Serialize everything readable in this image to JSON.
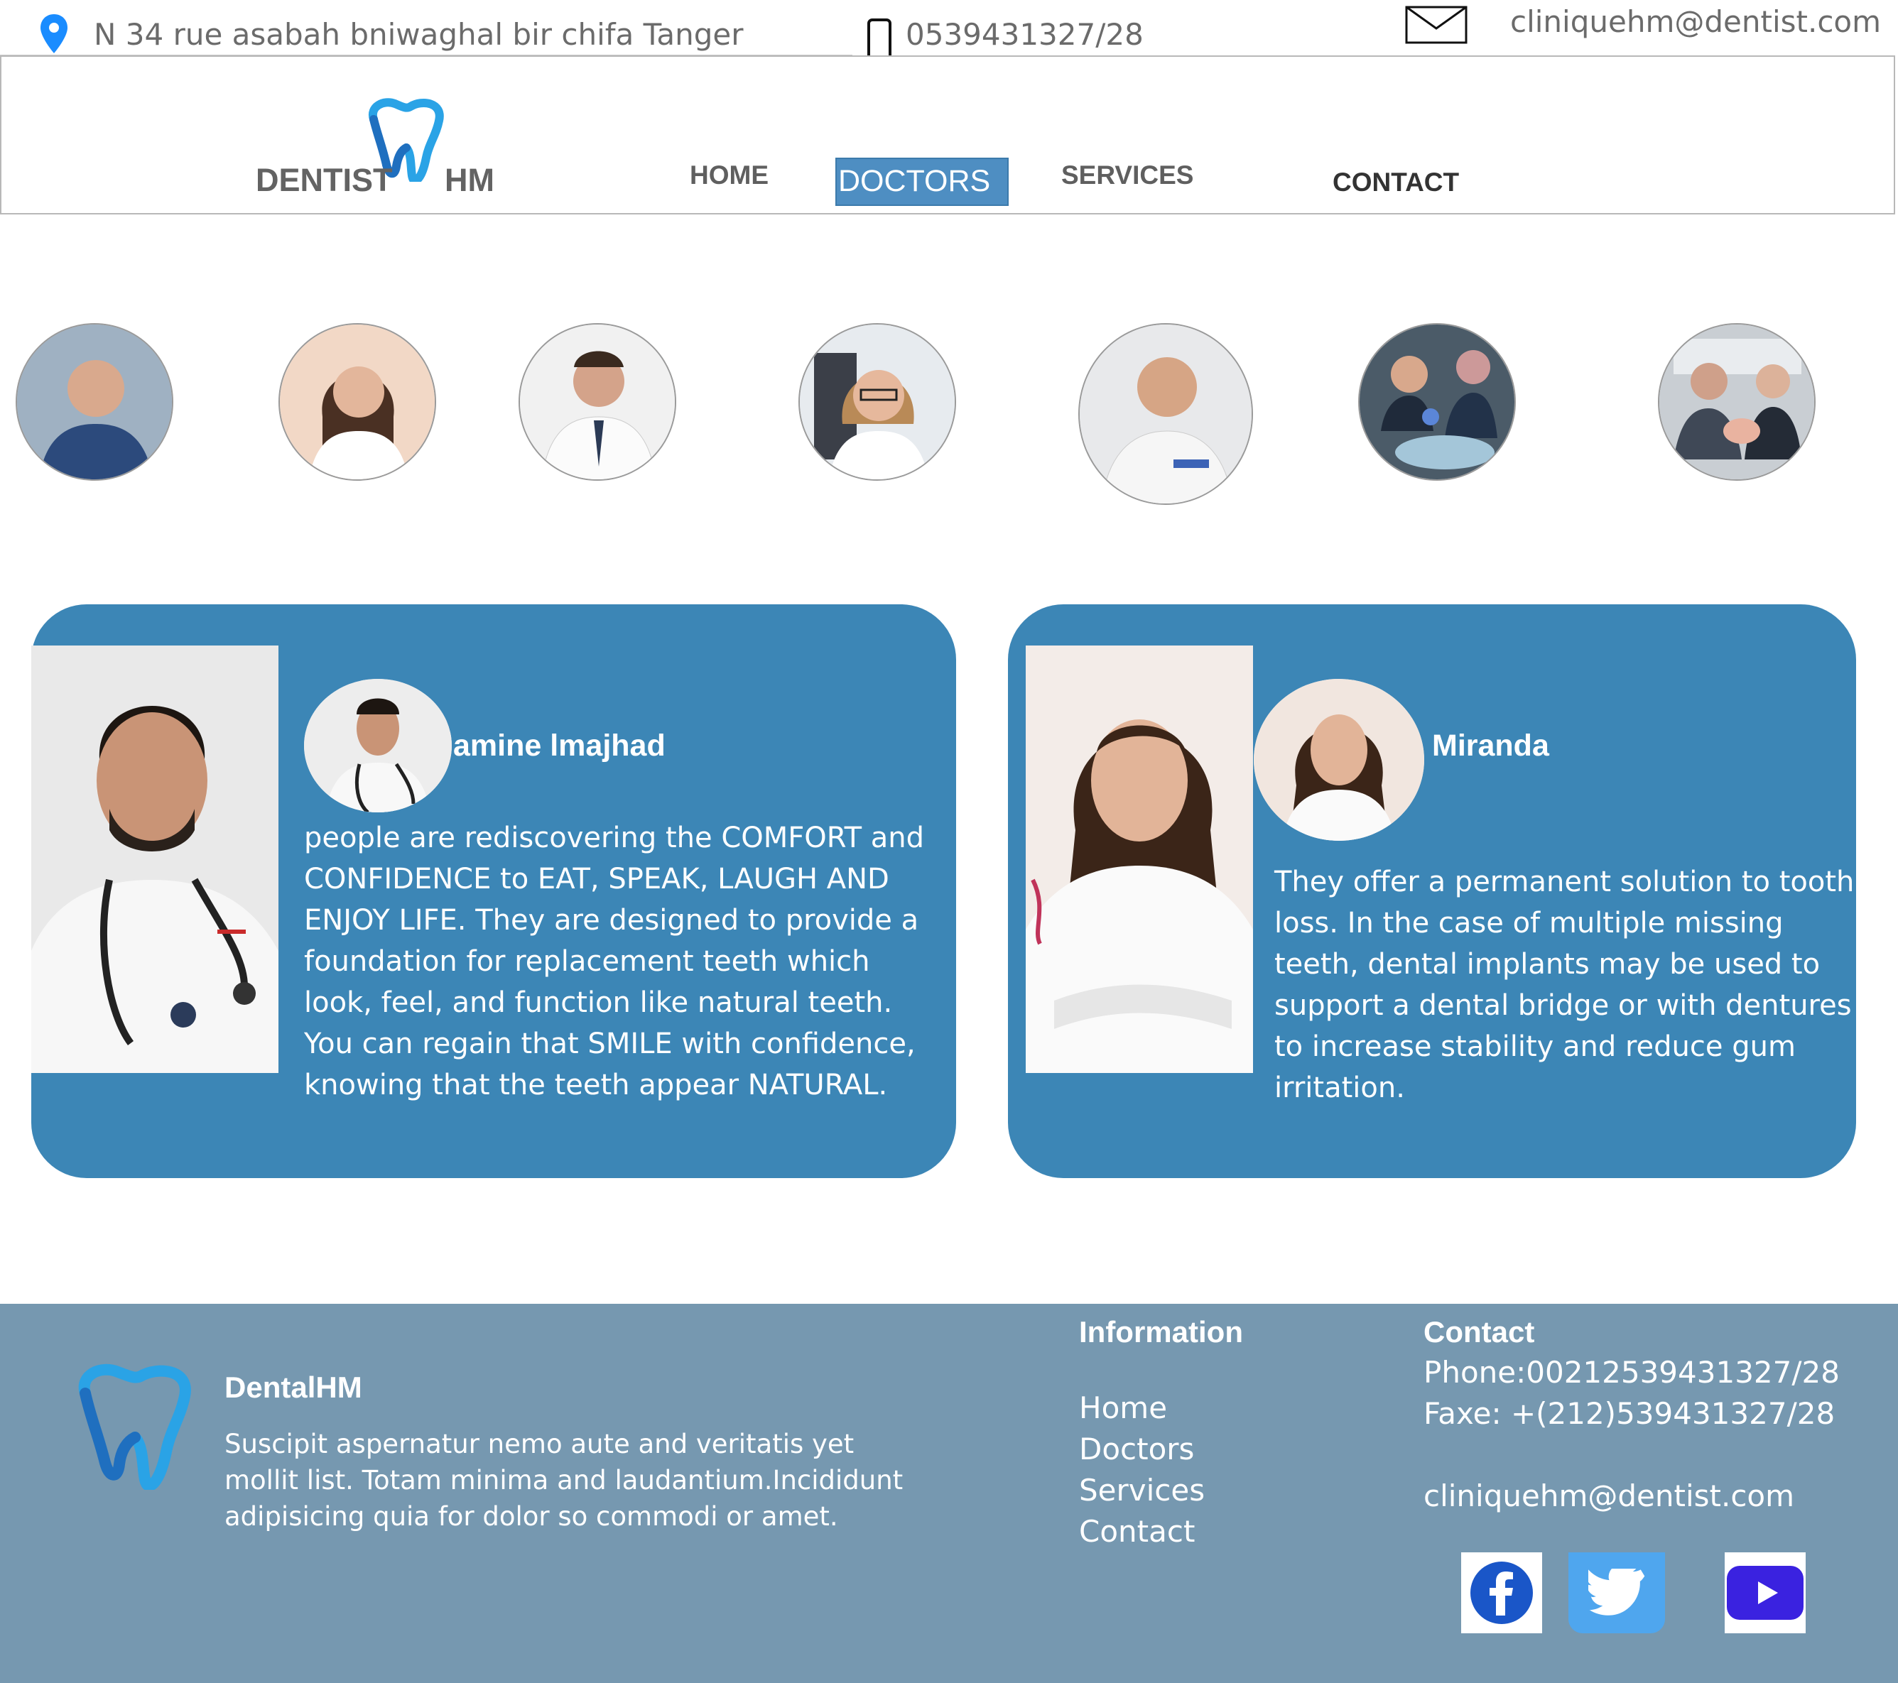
{
  "topbar": {
    "address": "N 34 rue asabah bniwaghal bir chifa Tanger",
    "phone": "0539431327/28",
    "email": "cliniquehm@dentist.com"
  },
  "logo": {
    "word_left": "DENTIST",
    "word_right": "HM",
    "icon": "tooth-logo-icon"
  },
  "nav": {
    "items": [
      {
        "label": "HOME"
      },
      {
        "label": "DOCTORS",
        "active": true
      },
      {
        "label": "SERVICES"
      },
      {
        "label": "CONTACT"
      }
    ]
  },
  "doctor_gallery": {
    "count": 7
  },
  "cards": [
    {
      "name": "amine lmajhad",
      "text": "people are rediscovering the COMFORT and CONFIDENCE to EAT, SPEAK, LAUGH AND ENJOY LIFE. They are designed to provide a foundation for replacement teeth which look, feel, and function like natural teeth. You can regain that SMILE with confidence, knowing that the teeth appear NATURAL."
    },
    {
      "name": "Miranda",
      "text": "They offer a permanent solution to tooth loss. In the case of multiple missing teeth, dental implants may be used to support a dental bridge or with dentures to increase stability and reduce gum irritation."
    }
  ],
  "footer": {
    "brand": "DentalHM",
    "description": "Suscipit aspernatur nemo aute and veritatis yet mollit list. Totam minima and laudantium.Incididunt adipisicing quia for dolor so commodi or amet.",
    "info_title": "Information",
    "links": [
      "Home",
      "Doctors",
      "Services",
      "Contact"
    ],
    "contact_title": "Contact",
    "phone": "Phone:00212539431327/28",
    "fax": "Faxe: +(212)539431327/28",
    "email": "cliniquehm@dentist.com"
  },
  "colors": {
    "card": "#3c86b6",
    "footer": "#7698b0",
    "accent": "#4e8ec2",
    "location": "#1a8cff"
  }
}
